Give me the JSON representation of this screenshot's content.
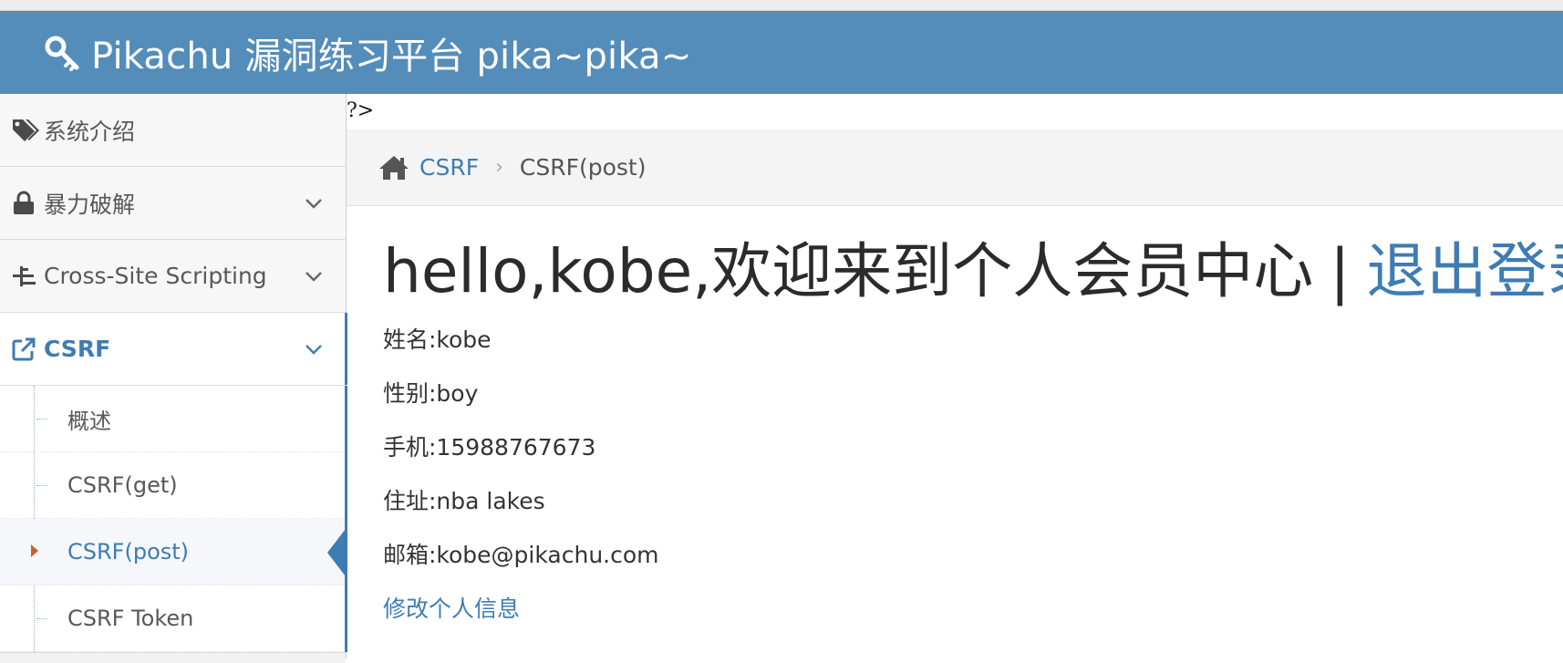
{
  "app": {
    "title": "Pikachu 漏洞练习平台 pika~pika~",
    "accent_color": "#548dba",
    "link_color": "#3e7cb4",
    "icon": "key-icon"
  },
  "sidebar": {
    "items": [
      {
        "label": "系统介绍",
        "icon": "tags-icon",
        "expandable": false
      },
      {
        "label": "暴力破解",
        "icon": "lock-icon",
        "expandable": true
      },
      {
        "label": "Cross-Site Scripting",
        "icon": "sitemap-icon",
        "expandable": true
      },
      {
        "label": "CSRF",
        "icon": "share-square-icon",
        "expandable": true,
        "active": true
      }
    ],
    "csrf_submenu": [
      {
        "label": "概述"
      },
      {
        "label": "CSRF(get)"
      },
      {
        "label": "CSRF(post)",
        "active": true
      },
      {
        "label": "CSRF Token"
      }
    ]
  },
  "main": {
    "php_leak": "?>",
    "breadcrumb": {
      "home_icon": "home-icon",
      "parent": "CSRF",
      "separator": "›",
      "current": "CSRF(post)"
    },
    "welcome": {
      "greeting": "hello,kobe,欢迎来到个人会员中心",
      "separator": "|",
      "logout": "退出登录"
    },
    "profile": {
      "name": "姓名:kobe",
      "sex": "性别:boy",
      "phone": "手机:15988767673",
      "address": "住址:nba lakes",
      "email": "邮箱:kobe@pikachu.com"
    },
    "edit_link": "修改个人信息"
  }
}
